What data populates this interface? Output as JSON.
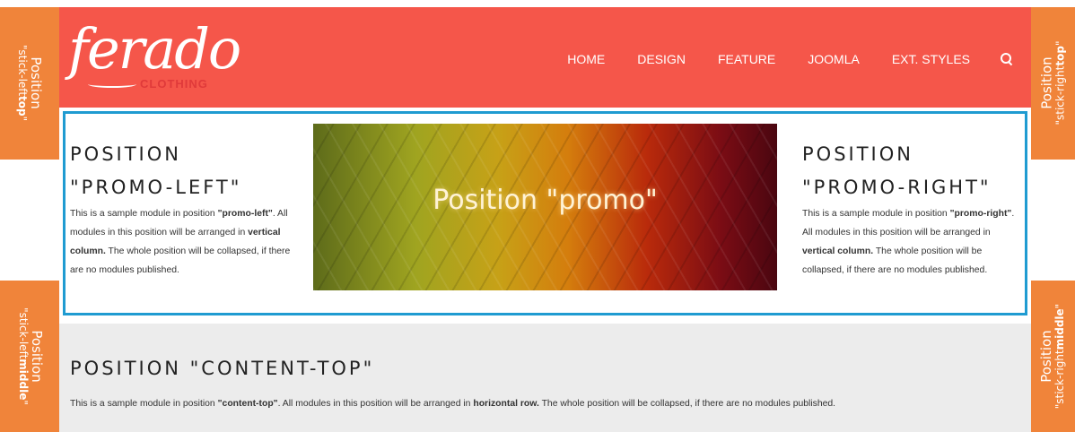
{
  "stick_tabs": {
    "left_top": {
      "line1": "Position",
      "prefix": "\"stick-left",
      "bold": "top",
      "suffix": "\""
    },
    "left_middle": {
      "line1": "Position",
      "prefix": "\"stick-left",
      "bold": "middle",
      "suffix": "\""
    },
    "right_top": {
      "line1": "Position",
      "prefix": "\"stick-right",
      "bold": "top",
      "suffix": "\""
    },
    "right_middle": {
      "line1": "Position",
      "prefix": "\"stick-right",
      "bold": "middle",
      "suffix": "\""
    }
  },
  "header": {
    "logo_word": "ferado",
    "logo_sub": "CLOTHING",
    "nav": [
      "HOME",
      "DESIGN",
      "FEATURE",
      "JOOMLA",
      "EXT. STYLES"
    ],
    "search_icon": "search-icon"
  },
  "promo_left": {
    "title_line1": "POSITION",
    "title_line2": "\"PROMO-LEFT\"",
    "text_a": "This is a sample module in position ",
    "text_b": "\"promo-left\"",
    "text_c": ". All modules in this position will be arranged in ",
    "text_d": "vertical column.",
    "text_e": " The whole position will be collapsed, if there are no modules published."
  },
  "promo": {
    "caption": "Position \"promo\""
  },
  "promo_right": {
    "title_line1": "POSITION",
    "title_line2": "\"PROMO-RIGHT\"",
    "text_a": "This is a sample module in position ",
    "text_b": "\"promo-right\"",
    "text_c": ". All modules in this position will be arranged in ",
    "text_d": "vertical column.",
    "text_e": " The whole position will be collapsed, if there are no modules published."
  },
  "content_top": {
    "title": "POSITION \"CONTENT-TOP\"",
    "text_a": "This is a sample module in position ",
    "text_b": "\"content-top\"",
    "text_c": ". All modules in this position will be arranged in ",
    "text_d": "horizontal row.",
    "text_e": " The whole position will be collapsed, if there are no modules published."
  },
  "colors": {
    "header": "#f5564a",
    "stick": "#f0843a",
    "promo_border": "#1f9bd1",
    "content_top_bg": "#ececec"
  }
}
